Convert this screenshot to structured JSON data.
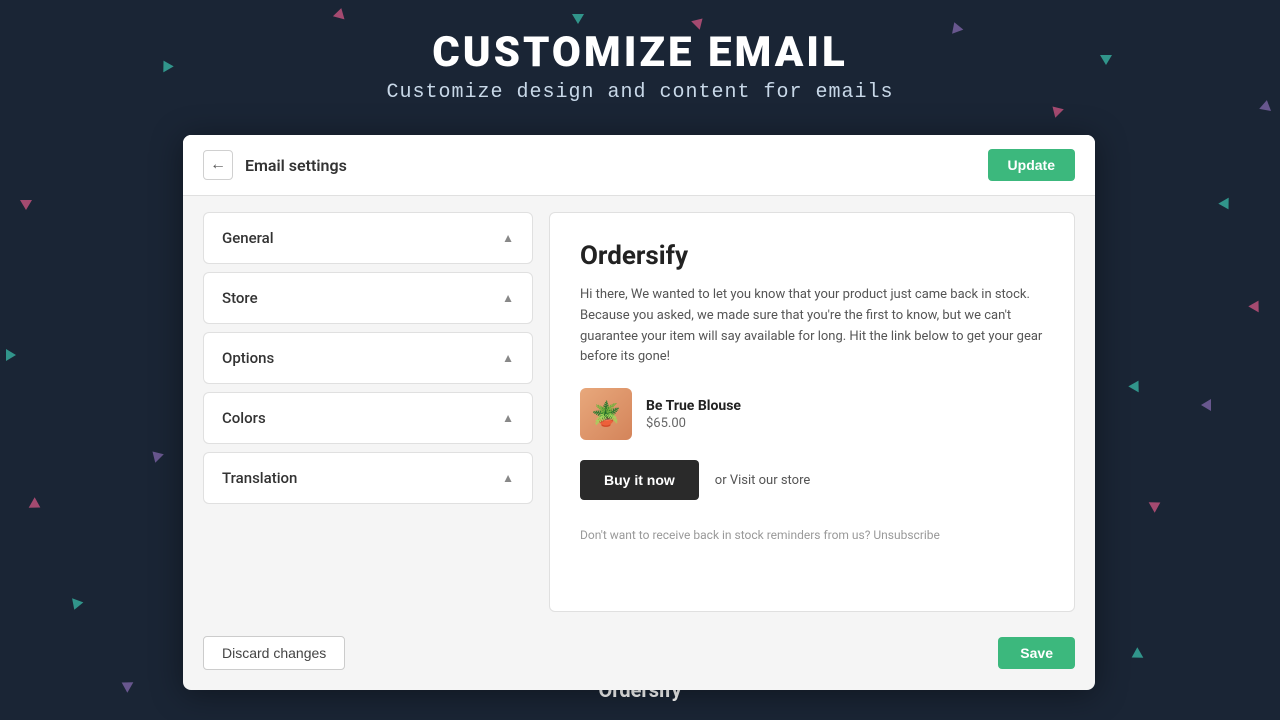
{
  "page": {
    "title": "CUSTOMIZE EMAIL",
    "subtitle": "Customize design and content for emails"
  },
  "modal": {
    "header": {
      "title": "Email settings",
      "back_label": "←",
      "update_label": "Update"
    },
    "sidebar": {
      "items": [
        {
          "id": "general",
          "label": "General"
        },
        {
          "id": "store",
          "label": "Store"
        },
        {
          "id": "options",
          "label": "Options"
        },
        {
          "id": "colors",
          "label": "Colors"
        },
        {
          "id": "translation",
          "label": "Translation"
        }
      ]
    },
    "preview": {
      "brand": "Ordersify",
      "body_text": "Hi there, We wanted to let you know that your product just came back in stock. Because you asked, we made sure that you're the first to know, but we can't guarantee your item will say available for long. Hit the link below to get your gear before its gone!",
      "product": {
        "name": "Be True Blouse",
        "price": "$65.00"
      },
      "buy_label": "Buy it now",
      "visit_label": "or Visit our store",
      "unsubscribe": "Don't want to receive back in stock reminders from us? Unsubscribe"
    },
    "footer": {
      "discard_label": "Discard changes",
      "save_label": "Save"
    }
  },
  "footer": {
    "brand": "Ordersify"
  },
  "colors": {
    "accent": "#3cb87d",
    "background": "#1a2535"
  }
}
